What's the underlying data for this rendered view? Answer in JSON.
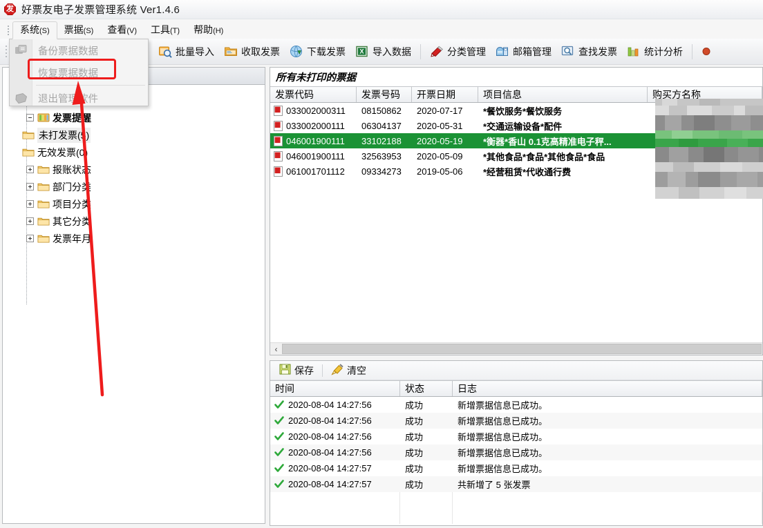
{
  "window": {
    "title": "好票友电子发票管理系统 Ver1.4.6",
    "icon": "invoice-app-icon",
    "icon_glyph": "发"
  },
  "menubar": [
    {
      "name": "system",
      "label": "系统",
      "accel": "(S)",
      "open": true
    },
    {
      "name": "bills",
      "label": "票据",
      "accel": "(S)",
      "open": false
    },
    {
      "name": "view",
      "label": "查看",
      "accel": "(V)",
      "open": false
    },
    {
      "name": "tools",
      "label": "工具",
      "accel": "(T)",
      "open": false
    },
    {
      "name": "help",
      "label": "帮助",
      "accel": "(H)",
      "open": false
    }
  ],
  "system_menu": {
    "items": [
      {
        "label": "备份票据数据",
        "icon": "backup-icon",
        "disabled": true,
        "highlighted": false
      },
      {
        "label": "恢复票据数据",
        "icon": "restore-icon",
        "disabled": true,
        "highlighted": true
      },
      {
        "label": "退出管理软件",
        "icon": "exit-icon",
        "disabled": true,
        "highlighted": false
      }
    ]
  },
  "annotation": {
    "box_color": "#ee1c1c",
    "arrow_color": "#ee1c1c",
    "target_label": "恢复票据数据"
  },
  "toolbar": {
    "buttons": [
      {
        "label": "批量导入",
        "icon": "batch-import-icon"
      },
      {
        "label": "收取发票",
        "icon": "receive-invoice-icon"
      },
      {
        "label": "下载发票",
        "icon": "download-invoice-icon"
      },
      {
        "label": "导入数据",
        "icon": "excel-import-icon"
      },
      {
        "label": "分类管理",
        "icon": "category-manage-icon"
      },
      {
        "label": "邮箱管理",
        "icon": "mailbox-manage-icon"
      },
      {
        "label": "查找发票",
        "icon": "search-invoice-icon"
      },
      {
        "label": "统计分析",
        "icon": "statistics-icon"
      }
    ]
  },
  "tree": {
    "nodes": [
      {
        "label": "发票提醒",
        "level": 0,
        "expanded": true,
        "bold": true,
        "icon": "invoice-reminder-icon",
        "selected": false
      },
      {
        "label": "未打发票(5)",
        "level": 1,
        "expanded": null,
        "bold": false,
        "icon": "folder-icon",
        "selected": true
      },
      {
        "label": "无效发票(0)",
        "level": 1,
        "expanded": null,
        "bold": false,
        "icon": "folder-icon",
        "selected": false
      },
      {
        "label": "报账状态",
        "level": 0,
        "expanded": false,
        "bold": false,
        "icon": "folder-icon",
        "selected": false
      },
      {
        "label": "部门分类",
        "level": 0,
        "expanded": false,
        "bold": false,
        "icon": "folder-icon",
        "selected": false
      },
      {
        "label": "项目分类",
        "level": 0,
        "expanded": false,
        "bold": false,
        "icon": "folder-icon",
        "selected": false
      },
      {
        "label": "其它分类",
        "level": 0,
        "expanded": false,
        "bold": false,
        "icon": "folder-icon",
        "selected": false
      },
      {
        "label": "发票年月",
        "level": 0,
        "expanded": false,
        "bold": false,
        "icon": "folder-icon",
        "selected": false
      }
    ]
  },
  "invoice_list": {
    "caption": "所有未打印的票据",
    "columns": [
      "发票代码",
      "发票号码",
      "开票日期",
      "项目信息",
      "购买方名称"
    ],
    "selected_row_color": "#1b9235",
    "rows": [
      {
        "code": "033002000311",
        "number": "08150862",
        "date": "2020-07-17",
        "items": "*餐饮服务*餐饮服务",
        "buyer": "",
        "selected": false
      },
      {
        "code": "033002000111",
        "number": "06304137",
        "date": "2020-05-31",
        "items": "*交通运输设备*配件",
        "buyer": "",
        "selected": false
      },
      {
        "code": "046001900111",
        "number": "33102188",
        "date": "2020-05-19",
        "items": "*衡器*香山 0.1克高精准电子秤...",
        "buyer": "",
        "selected": true
      },
      {
        "code": "046001900111",
        "number": "32563953",
        "date": "2020-05-09",
        "items": "*其他食品*食品*其他食品*食品",
        "buyer": "",
        "selected": false
      },
      {
        "code": "061001701112",
        "number": "09334273",
        "date": "2019-05-06",
        "items": "*经营租赁*代收通行费",
        "buyer": "",
        "selected": false
      }
    ],
    "scrollbar": {
      "left_arrow": "‹"
    }
  },
  "log_panel": {
    "toolbar": [
      {
        "label": "保存",
        "icon": "save-icon"
      },
      {
        "label": "清空",
        "icon": "clear-icon"
      }
    ],
    "columns": [
      "时间",
      "状态",
      "日志"
    ],
    "rows": [
      {
        "time": "2020-08-04 14:27:56",
        "status": "成功",
        "message": "新增票据信息已成功。"
      },
      {
        "time": "2020-08-04 14:27:56",
        "status": "成功",
        "message": "新增票据信息已成功。"
      },
      {
        "time": "2020-08-04 14:27:56",
        "status": "成功",
        "message": "新增票据信息已成功。"
      },
      {
        "time": "2020-08-04 14:27:56",
        "status": "成功",
        "message": "新增票据信息已成功。"
      },
      {
        "time": "2020-08-04 14:27:57",
        "status": "成功",
        "message": "新增票据信息已成功。"
      },
      {
        "time": "2020-08-04 14:27:57",
        "status": "成功",
        "message": "共新增了 5 张发票"
      }
    ]
  }
}
